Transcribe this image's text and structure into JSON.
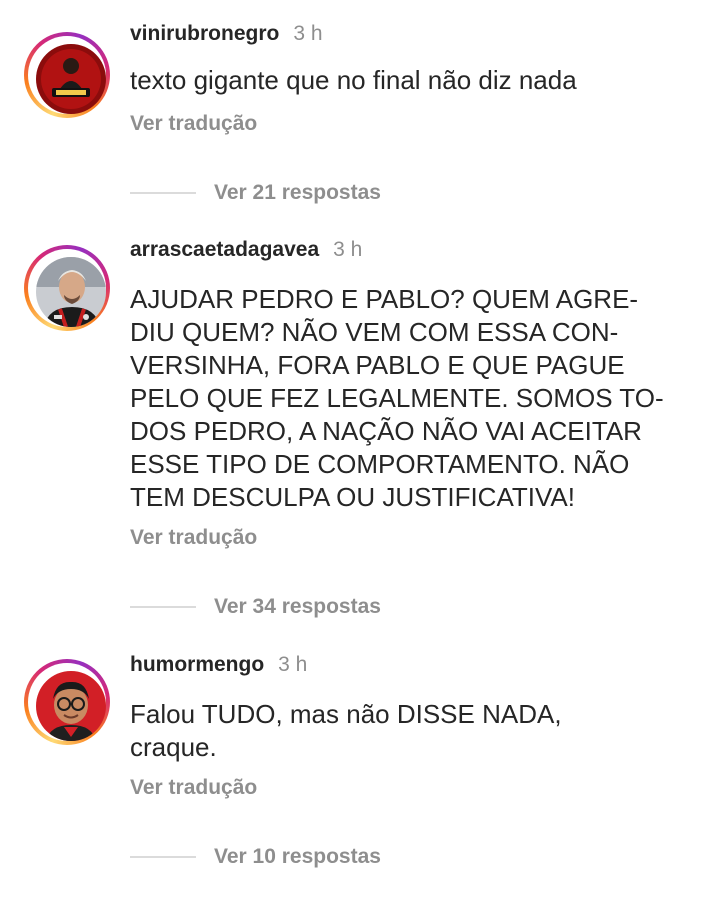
{
  "comments": [
    {
      "username": "vinirubronegro",
      "time": "3 h",
      "text_lines": [
        "texto gigante que no final não diz nada"
      ],
      "translate_label": "Ver tradução",
      "replies_label": "Ver 21 respostas",
      "avatar_icon": "flamengo-fan-avatar"
    },
    {
      "username": "arrascaetadagavea",
      "time": "3 h",
      "text_lines": [
        "AJUDAR PEDRO E PABLO? QUEM AGRE-",
        "DIU QUEM? NÃO VEM COM ESSA CON-",
        "VERSINHA, FORA PABLO E QUE PAGUE",
        "PELO QUE FEZ LEGALMENTE. SOMOS TO-",
        "DOS PEDRO, A NAÇÃO NÃO VAI ACEITAR",
        "ESSE TIPO DE COMPORTAMENTO. NÃO",
        "TEM DESCULPA OU JUSTIFICATIVA!"
      ],
      "translate_label": "Ver tradução",
      "replies_label": "Ver 34 respostas",
      "avatar_icon": "player-photo-avatar"
    },
    {
      "username": "humormengo",
      "time": "3 h",
      "text_lines": [
        "Falou TUDO, mas não DISSE NADA,",
        "craque."
      ],
      "translate_label": "Ver tradução",
      "replies_label": "Ver 10 respostas",
      "avatar_icon": "cartoon-avatar"
    }
  ],
  "colors": {
    "text": "#262626",
    "secondary": "#8e8e8e",
    "divider": "#dbdbdb",
    "ring_gradient": [
      "#feda75",
      "#fa7e1e",
      "#d62976",
      "#962fbf"
    ]
  }
}
